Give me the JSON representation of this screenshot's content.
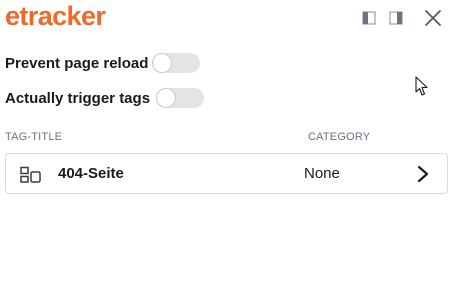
{
  "brand": {
    "logo_text": "etracker",
    "color": "#ee6a2a"
  },
  "window_controls": {
    "dock_left_icon": "dock-left-icon",
    "dock_right_icon": "dock-right-icon",
    "close_icon": "close-icon"
  },
  "settings": [
    {
      "label": "Prevent page reload",
      "enabled": false
    },
    {
      "label": "Actually trigger tags",
      "enabled": false
    }
  ],
  "table": {
    "headers": {
      "title": "TAG-TITLE",
      "category": "CATEGORY"
    },
    "rows": [
      {
        "icon": "tag-layout-icon",
        "title": "404-Seite",
        "category": "None",
        "action_icon": "chevron-right-icon"
      }
    ]
  }
}
